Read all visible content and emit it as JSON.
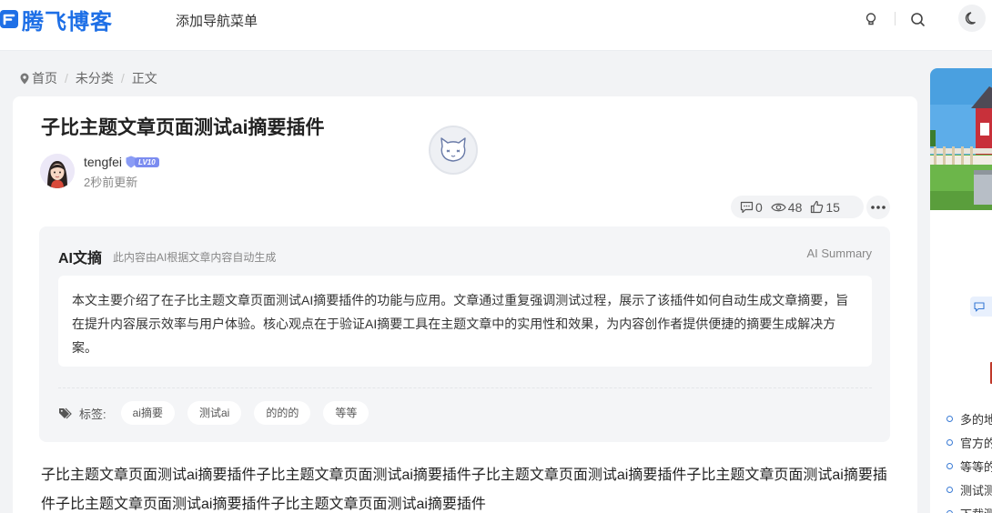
{
  "header": {
    "logo_text": "腾飞博客",
    "nav_label": "添加导航菜单",
    "icons": [
      "bulb-icon",
      "search-icon",
      "moon-icon"
    ],
    "brand_color": "#1e6fe6"
  },
  "breadcrumb": {
    "items": [
      "首页",
      "未分类",
      "正文"
    ]
  },
  "post": {
    "title": "子比主题文章页面测试ai摘要插件",
    "author": "tengfei",
    "level": "LV10",
    "updated": "2秒前更新",
    "stats": {
      "comments": "0",
      "views": "48",
      "likes": "15"
    },
    "body": "子比主题文章页面测试ai摘要插件子比主题文章页面测试ai摘要插件子比主题文章页面测试ai摘要插件子比主题文章页面测试ai摘要插件子比主题文章页面测试ai摘要插件子比主题文章页面测试ai摘要插件"
  },
  "ai_summary": {
    "title": "AI文摘",
    "subtitle": "此内容由AI根据文章内容自动生成",
    "label": "AI Summary",
    "content": "本文主要介绍了在子比主题文章页面测试AI摘要插件的功能与应用。文章通过重复强调测试过程，展示了该插件如何自动生成文章摘要，旨在提升内容展示效率与用户体验。核心观点在于验证AI摘要工具在主题文章中的实用性和效果，为内容创作者提供便捷的摘要生成解决方案。"
  },
  "tags": {
    "label": "标签:",
    "items": [
      "ai摘要",
      "测试ai",
      "的的的",
      "等等"
    ]
  },
  "sidebar": {
    "items": [
      "多的地",
      "官方的",
      "等等的",
      "测试测",
      "下载测"
    ]
  }
}
